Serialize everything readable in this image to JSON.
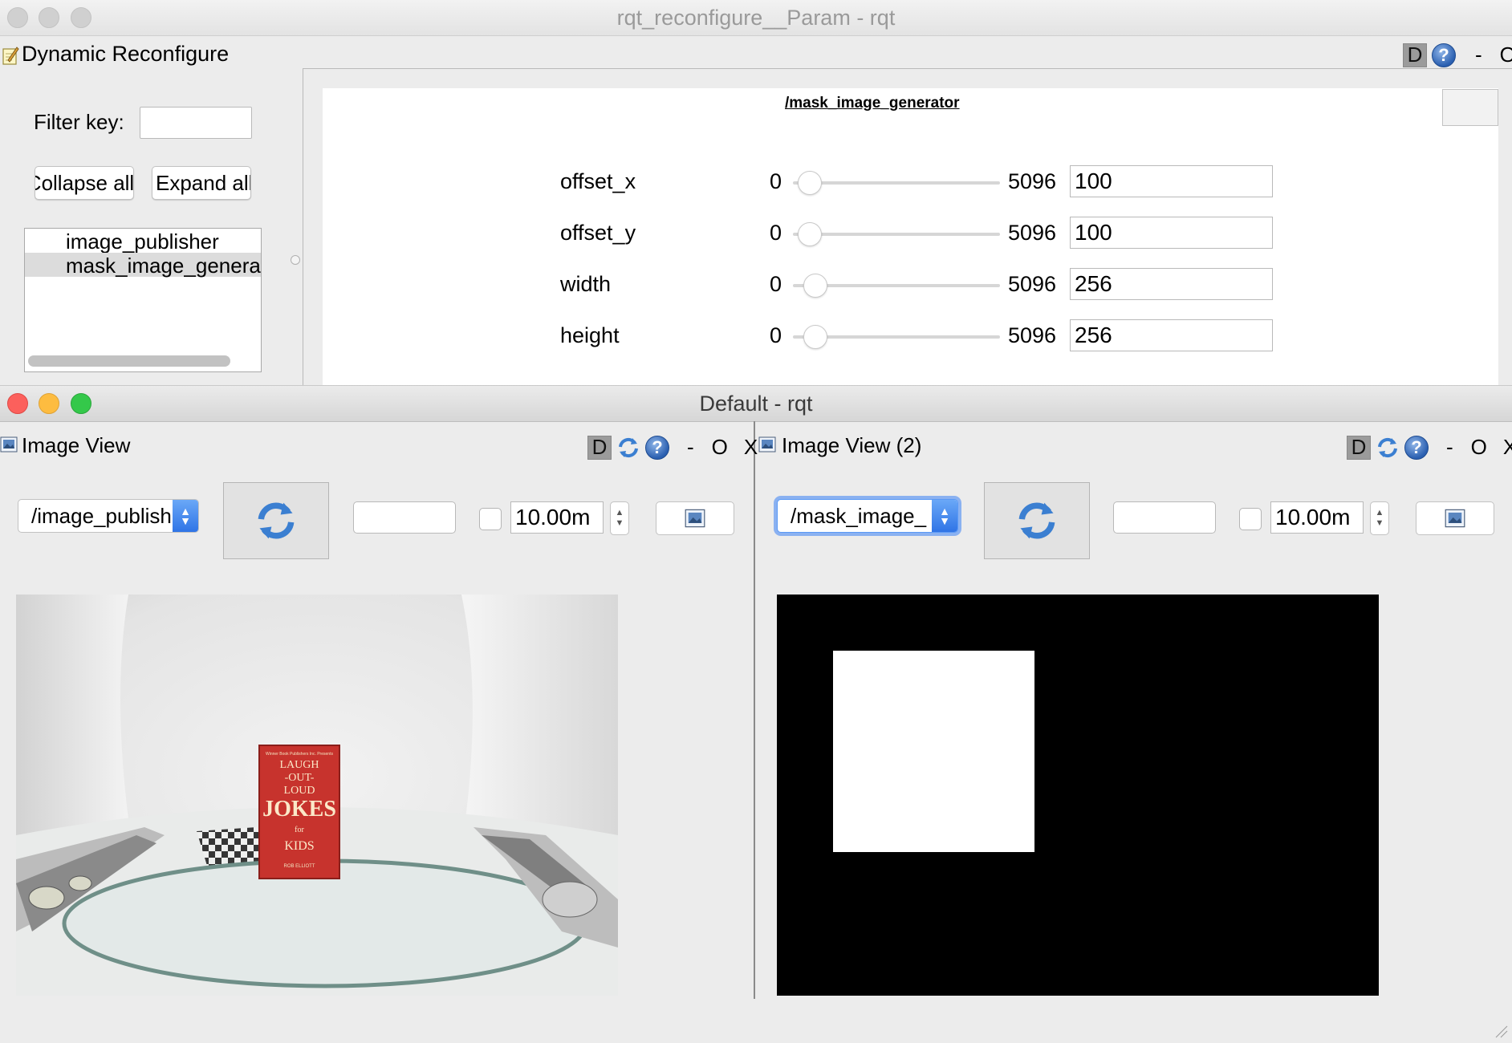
{
  "top_window": {
    "title": "rqt_reconfigure__Param - rqt",
    "panel_title": "Dynamic Reconfigure",
    "dock_d": "D",
    "dock_help": "?",
    "dock_minus": "-",
    "dock_o": "O",
    "filter_label": "Filter key:",
    "filter_value": "",
    "collapse_label": "Collapse all",
    "expand_label": "Expand all",
    "nodes": [
      "image_publisher",
      "mask_image_generator"
    ],
    "selected_node_index": 1,
    "node_header": "/mask_image_generator",
    "params": [
      {
        "name": "offset_x",
        "min": "0",
        "max": "5096",
        "value": "100",
        "fraction": 0.0196
      },
      {
        "name": "offset_y",
        "min": "0",
        "max": "5096",
        "value": "100",
        "fraction": 0.0196
      },
      {
        "name": "width",
        "min": "0",
        "max": "5096",
        "value": "256",
        "fraction": 0.0502
      },
      {
        "name": "height",
        "min": "0",
        "max": "5096",
        "value": "256",
        "fraction": 0.0502
      }
    ]
  },
  "bottom_window": {
    "title": "Default - rqt",
    "views": [
      {
        "title": "Image View",
        "topic": "/image_publisher",
        "topic_display": "/image_publish",
        "extra_field": "",
        "timeout": "10.00m",
        "dock_d": "D",
        "dock_help": "?",
        "dock_minus": "-",
        "dock_o": "O",
        "dock_x": "X",
        "focused": false
      },
      {
        "title": "Image View (2)",
        "topic": "/mask_image_generator",
        "topic_display": "/mask_image_",
        "extra_field": "",
        "timeout": "10.00m",
        "dock_d": "D",
        "dock_help": "?",
        "dock_minus": "-",
        "dock_o": "O",
        "dock_x": "X",
        "focused": true
      }
    ],
    "book_cover": {
      "lines": [
        "LAUGH",
        "-OUT-",
        "LOUD",
        "JOKES",
        "for",
        "KIDS"
      ],
      "top_text": "Winner Book Publishers Inc. Presents",
      "author": "ROB ELLIOTT"
    }
  },
  "colors": {
    "close": "#fc605c",
    "minimize": "#fdbc40",
    "zoom": "#34c84a",
    "accent": "#3b82f6",
    "mask_background": "#000000",
    "mask_foreground": "#ffffff"
  }
}
